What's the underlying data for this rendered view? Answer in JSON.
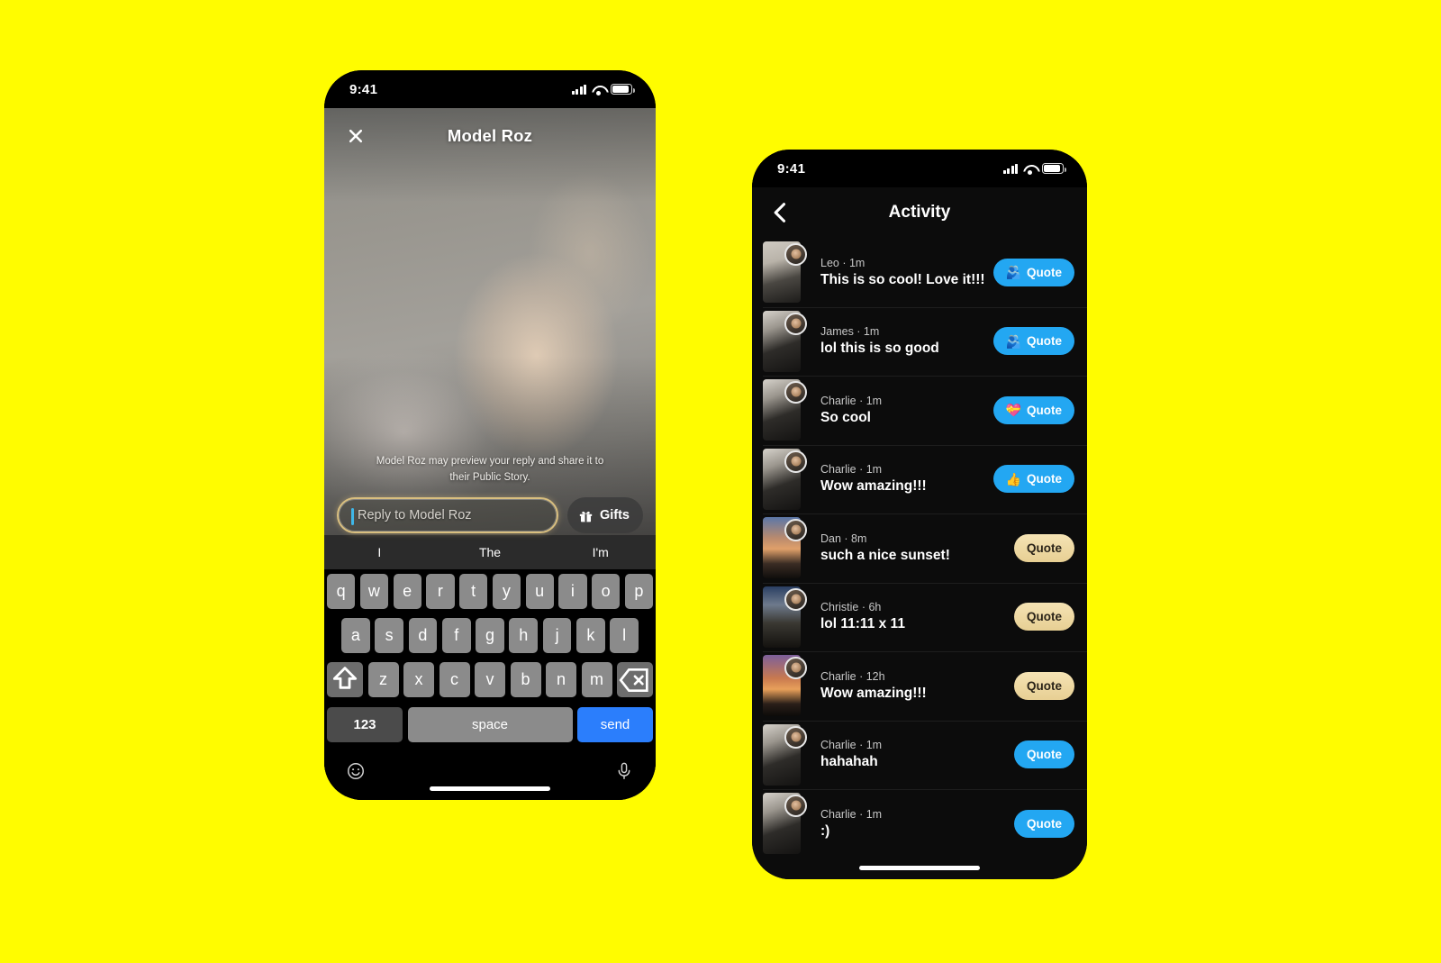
{
  "reply_screen": {
    "status": {
      "time": "9:41",
      "signal_icon": "cellular-signal-icon",
      "wifi_icon": "wifi-icon",
      "battery_icon": "battery-icon"
    },
    "header": {
      "close_icon": "close-icon",
      "title": "Model Roz"
    },
    "disclaimer": "Model Roz may preview your reply and share it to their Public Story.",
    "reply_input": {
      "placeholder": "Reply to Model Roz",
      "value": ""
    },
    "gifts_button": {
      "label": "Gifts",
      "icon": "gift-icon"
    },
    "keyboard": {
      "suggestions": [
        "I",
        "The",
        "I'm"
      ],
      "row1": [
        "q",
        "w",
        "e",
        "r",
        "t",
        "y",
        "u",
        "i",
        "o",
        "p"
      ],
      "row2": [
        "a",
        "s",
        "d",
        "f",
        "g",
        "h",
        "j",
        "k",
        "l"
      ],
      "row3_letters": [
        "z",
        "x",
        "c",
        "v",
        "b",
        "n",
        "m"
      ],
      "shift_icon": "shift-icon",
      "backspace_icon": "backspace-icon",
      "numbers_key": "123",
      "space_key": "space",
      "send_key": "send",
      "emoji_icon": "emoji-smiley-icon",
      "mic_icon": "microphone-icon"
    }
  },
  "activity_screen": {
    "status": {
      "time": "9:41",
      "signal_icon": "cellular-signal-icon",
      "wifi_icon": "wifi-icon",
      "battery_icon": "battery-icon"
    },
    "header": {
      "back_icon": "back-chevron-icon",
      "title": "Activity"
    },
    "rows": [
      {
        "name": "Leo",
        "time": "1m",
        "message": "This is so cool! Love it!!!",
        "quote_label": "Quote",
        "emoji": "🫂",
        "style": "blue",
        "thumb": "t-room"
      },
      {
        "name": "James",
        "time": "1m",
        "message": "lol this is so good",
        "quote_label": "Quote",
        "emoji": "🫂",
        "style": "blue",
        "thumb": "t-car"
      },
      {
        "name": "Charlie",
        "time": "1m",
        "message": "So cool",
        "quote_label": "Quote",
        "emoji": "💝",
        "style": "blue",
        "thumb": "t-car"
      },
      {
        "name": "Charlie",
        "time": "1m",
        "message": "Wow amazing!!!",
        "quote_label": "Quote",
        "emoji": "👍",
        "style": "blue",
        "thumb": "t-car"
      },
      {
        "name": "Dan",
        "time": "8m",
        "message": "such a nice sunset!",
        "quote_label": "Quote",
        "emoji": "",
        "style": "tan",
        "thumb": "t-sunset"
      },
      {
        "name": "Christie",
        "time": "6h",
        "message": "lol 11:11 x 11",
        "quote_label": "Quote",
        "emoji": "",
        "style": "tan",
        "thumb": "t-night"
      },
      {
        "name": "Charlie",
        "time": "12h",
        "message": "Wow amazing!!!",
        "quote_label": "Quote",
        "emoji": "",
        "style": "tan",
        "thumb": "t-palm"
      },
      {
        "name": "Charlie",
        "time": "1m",
        "message": "hahahah",
        "quote_label": "Quote",
        "emoji": "",
        "style": "blue",
        "thumb": "t-car"
      },
      {
        "name": "Charlie",
        "time": "1m",
        "message": ":)",
        "quote_label": "Quote",
        "emoji": "",
        "style": "blue",
        "thumb": "t-car"
      }
    ]
  },
  "colors": {
    "background": "#FFFC00",
    "quote_blue": "#23A7F2",
    "quote_tan": "#EFD9A0",
    "send_blue": "#2B7EFC",
    "input_border": "#D9BF7F"
  }
}
